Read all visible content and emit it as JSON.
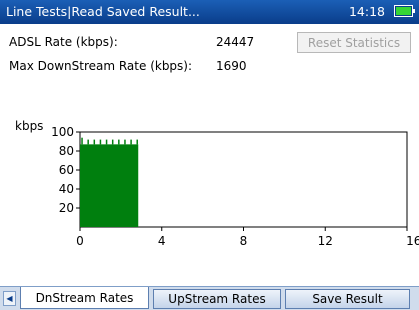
{
  "header": {
    "title": "Line Tests|Read Saved Result...",
    "time": "14:18"
  },
  "stats": {
    "adsl_rate_label": "ADSL Rate (kbps):",
    "adsl_rate_value": "24447",
    "max_downstream_label": "Max DownStream Rate (kbps):",
    "max_downstream_value": "1690",
    "reset_label": "Reset Statistics"
  },
  "chart_data": {
    "type": "bar",
    "title": "",
    "xlabel": "",
    "ylabel": "kbps",
    "x_unit": "min",
    "xlim": [
      0,
      16
    ],
    "ylim": [
      0,
      100
    ],
    "xticks": [
      0,
      4,
      8,
      12,
      16
    ],
    "yticks": [
      20,
      40,
      60,
      80,
      100
    ],
    "color": "#007f0e",
    "x": [
      0.1,
      0.4,
      0.7,
      1.0,
      1.3,
      1.6,
      1.9,
      2.2,
      2.5,
      2.8
    ],
    "values": [
      94,
      92,
      92,
      92,
      92,
      92,
      92,
      92,
      92,
      92
    ],
    "fill_range": [
      0,
      2.85
    ],
    "fill_level": 87
  },
  "tabs": [
    {
      "label": "DnStream Rates"
    },
    {
      "label": "UpStream Rates"
    },
    {
      "label": "Save Result"
    }
  ]
}
